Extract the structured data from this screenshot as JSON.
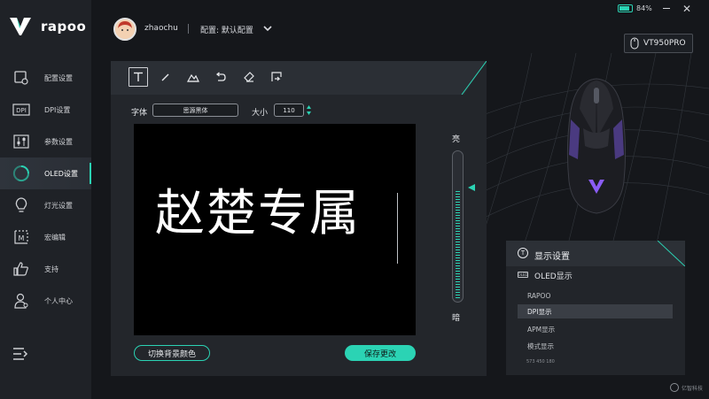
{
  "app": {
    "brand": "rapoo",
    "accent_color": "#2bd3b4",
    "battery": "84%",
    "battery_level": 0.84,
    "device": "VT950PRO"
  },
  "user": {
    "name": "zhaochu",
    "config": "配置: 默认配置"
  },
  "sidebar": {
    "items": [
      {
        "label": "配置设置",
        "icon": "config-icon"
      },
      {
        "label": "DPI设置",
        "icon": "dpi-icon"
      },
      {
        "label": "参数设置",
        "icon": "sliders-icon"
      },
      {
        "label": "OLED设置",
        "icon": "oled-icon",
        "active": true
      },
      {
        "label": "灯光设置",
        "icon": "bulb-icon"
      },
      {
        "label": "宏编辑",
        "icon": "macro-icon"
      },
      {
        "label": "支持",
        "icon": "thumbs-up-icon"
      },
      {
        "label": "个人中心",
        "icon": "user-icon"
      }
    ]
  },
  "editor": {
    "tools": [
      "text-tool-icon",
      "pen-tool-icon",
      "image-tool-icon",
      "undo-icon",
      "eraser-icon",
      "export-icon"
    ],
    "font_label": "字体",
    "font_value": "思源黑体",
    "size_label": "大小",
    "size_value": "110",
    "canvas_text": "赵楚专属",
    "brightness_high": "亮",
    "brightness_low": "暗",
    "brightness_level": 0.75,
    "toggle_bg_label": "切换背景颜色",
    "save_label": "保存更改"
  },
  "display_panel": {
    "icon_letter": "T",
    "title": "显示设置",
    "oled_tag": "OLED",
    "oled_label": "OLED显示",
    "options": [
      "RAPOO",
      "DPI显示",
      "APM显示",
      "模式显示"
    ],
    "selected": "DPI显示",
    "footnote": "573 450 180"
  },
  "watermark": "亿智科技"
}
